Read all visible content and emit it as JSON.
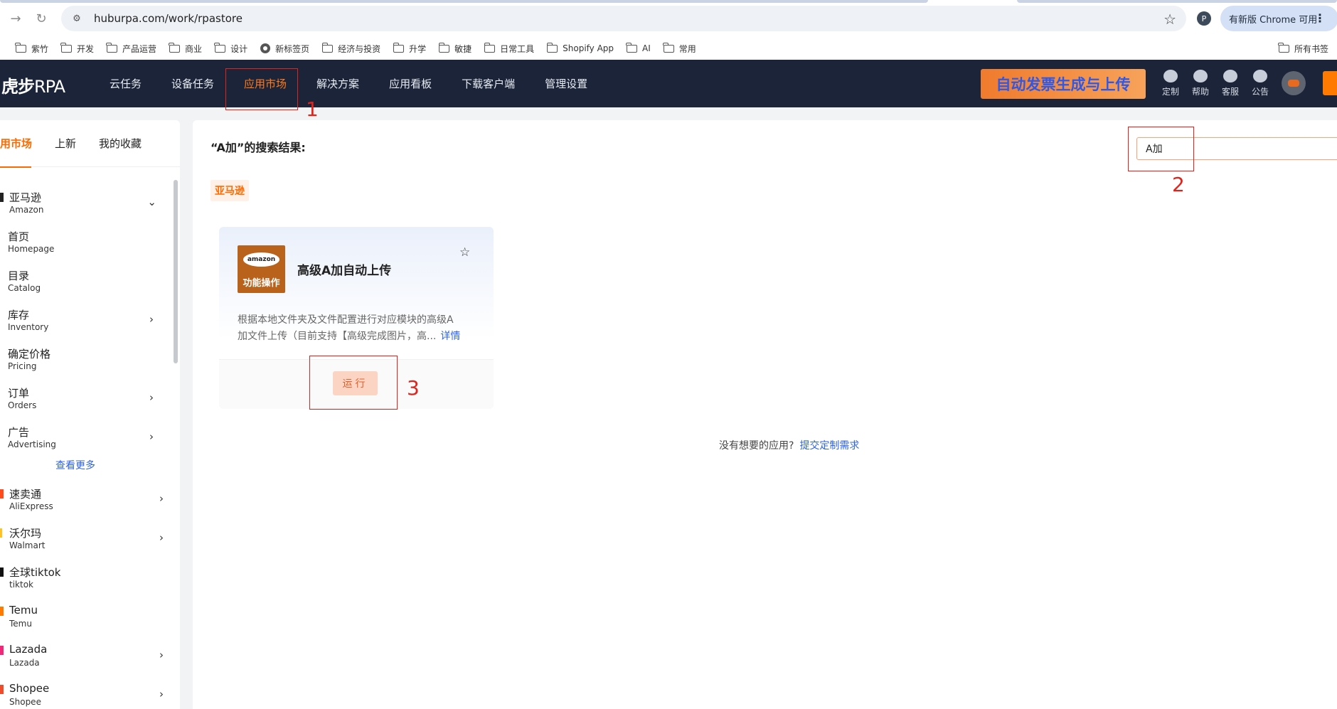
{
  "browser": {
    "url": "huburpa.com/work/rpastore",
    "profile_initial": "P",
    "update_label": "有新版 Chrome 可用",
    "bookmarks": [
      "紫竹",
      "开发",
      "产品运营",
      "商业",
      "设计",
      "新标签页",
      "经济与投资",
      "升学",
      "敏捷",
      "日常工具",
      "Shopify App",
      "AI",
      "常用"
    ],
    "all_bookmarks": "所有书签"
  },
  "header": {
    "logo_bold": "虎步",
    "logo_light": "RPA",
    "nav": [
      "云任务",
      "设备任务",
      "应用市场",
      "解决方案",
      "应用看板",
      "下载客户端",
      "管理设置"
    ],
    "active_nav": "应用市场",
    "promo": "自动发票生成与上传",
    "icons": [
      {
        "label": "定制",
        "icon": "edit-icon"
      },
      {
        "label": "帮助",
        "icon": "help-icon"
      },
      {
        "label": "客服",
        "icon": "headset-icon"
      },
      {
        "label": "公告",
        "icon": "megaphone-icon"
      }
    ]
  },
  "sidebar": {
    "tabs": [
      "用市场",
      "上新",
      "我的收藏"
    ],
    "amazon": {
      "zh": "亚马逊",
      "en": "Amazon"
    },
    "amazon_sub": [
      {
        "zh": "首页",
        "en": "Homepage"
      },
      {
        "zh": "目录",
        "en": "Catalog"
      },
      {
        "zh": "库存",
        "en": "Inventory"
      },
      {
        "zh": "确定价格",
        "en": "Pricing"
      },
      {
        "zh": "订单",
        "en": "Orders"
      },
      {
        "zh": "广告",
        "en": "Advertising"
      }
    ],
    "see_more": "查看更多",
    "platforms": [
      {
        "zh": "速卖通",
        "en": "AliExpress"
      },
      {
        "zh": "沃尔玛",
        "en": "Walmart"
      },
      {
        "zh": "全球tiktok",
        "en": "tiktok"
      },
      {
        "zh": "Temu",
        "en": "Temu"
      },
      {
        "zh": "Lazada",
        "en": "Lazada"
      },
      {
        "zh": "Shopee",
        "en": "Shopee"
      }
    ]
  },
  "main": {
    "result_title": "“A加”的搜索结果:",
    "search_value": "A加",
    "category_chip": "亚马逊",
    "card": {
      "icon_brand": "amazon",
      "icon_label": "功能操作",
      "title": "高级A加自动上传",
      "desc_line1": "根据本地文件夹及文件配置进行对应模块的高级A",
      "desc_line2": "加文件上传（目前支持【高级完成图片，高...",
      "detail": "详情",
      "run": "运行"
    },
    "footer_text": "没有想要的应用?",
    "footer_link": "提交定制需求"
  },
  "annotations": [
    "1",
    "2",
    "3"
  ],
  "colors": {
    "accent": "#ff6a00",
    "header_bg": "#1b2438",
    "link": "#2d63e0",
    "annotation": "#e0231b"
  }
}
